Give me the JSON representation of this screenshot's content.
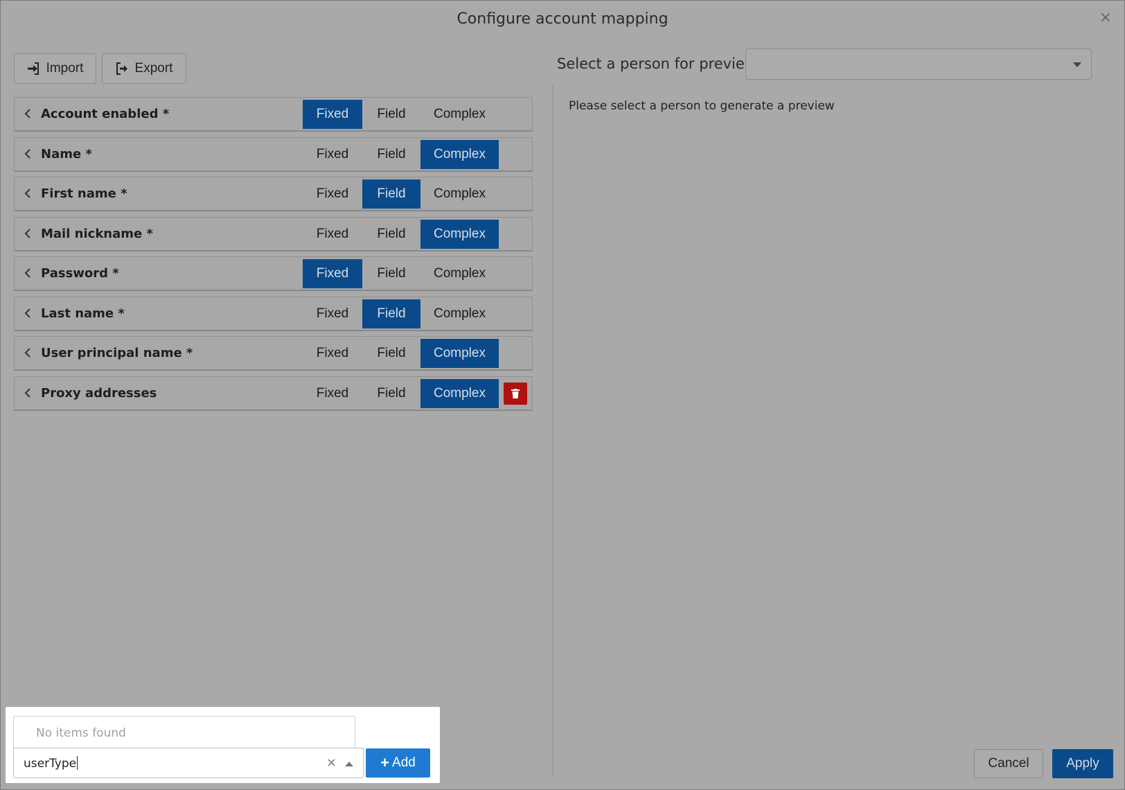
{
  "dialog": {
    "title": "Configure account mapping",
    "close_label": "×"
  },
  "toolbar": {
    "import_label": "Import",
    "export_label": "Export"
  },
  "options": [
    "Fixed",
    "Field",
    "Complex"
  ],
  "mappings": [
    {
      "label": "Account enabled *",
      "selected": "Fixed"
    },
    {
      "label": "Name *",
      "selected": "Complex"
    },
    {
      "label": "First name *",
      "selected": "Field"
    },
    {
      "label": "Mail nickname *",
      "selected": "Complex"
    },
    {
      "label": "Password *",
      "selected": "Fixed"
    },
    {
      "label": "Last name *",
      "selected": "Field"
    },
    {
      "label": "User principal name *",
      "selected": "Complex"
    },
    {
      "label": "Proxy addresses",
      "selected": "Complex",
      "deletable": true
    }
  ],
  "preview": {
    "label": "Select a person for preview",
    "selected_value": "",
    "message": "Please select a person to generate a preview"
  },
  "add_field": {
    "dropdown_message": "No items found",
    "input_value": "userType",
    "clear_label": "×",
    "add_label": "Add"
  },
  "footer": {
    "cancel_label": "Cancel",
    "apply_label": "Apply"
  },
  "colors": {
    "selected": "#0b4a8a",
    "delete": "#b01111",
    "add": "#1f7bd1"
  }
}
